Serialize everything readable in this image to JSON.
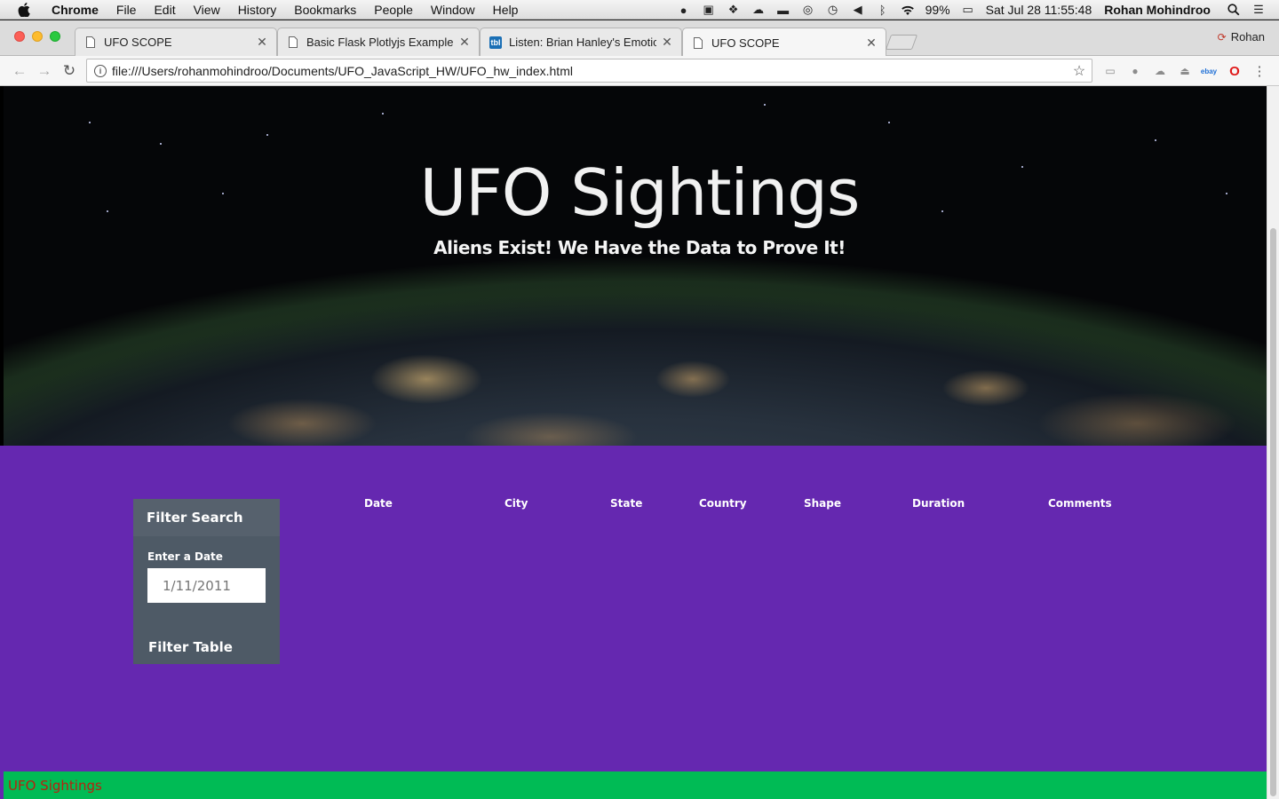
{
  "menubar": {
    "app_name": "Chrome",
    "items": [
      "File",
      "Edit",
      "View",
      "History",
      "Bookmarks",
      "People",
      "Window",
      "Help"
    ],
    "battery": "99%",
    "clock": "Sat Jul 28  11:55:48",
    "user": "Rohan Mohindroo"
  },
  "browser": {
    "tabs": [
      {
        "title": "UFO SCOPE",
        "icon": "page-icon"
      },
      {
        "title": "Basic Flask Plotlyjs Example",
        "icon": "page-icon"
      },
      {
        "title": "Listen: Brian Hanley's Emotion",
        "icon": "tbl-icon",
        "icon_text": "tbl"
      },
      {
        "title": "UFO SCOPE",
        "icon": "page-icon"
      }
    ],
    "profile_name": "Rohan",
    "url": "file:///Users/rohanmohindroo/Documents/UFO_JavaScript_HW/UFO_hw_index.html"
  },
  "hero": {
    "title": "UFO Sightings",
    "subtitle": "Aliens Exist! We Have the Data to Prove It!"
  },
  "filter": {
    "heading": "Filter Search",
    "date_label": "Enter a Date",
    "date_placeholder": "1/11/2011",
    "button_label": "Filter Table"
  },
  "table": {
    "columns": [
      "Date",
      "City",
      "State",
      "Country",
      "Shape",
      "Duration",
      "Comments"
    ]
  },
  "footer": {
    "text": "UFO Sightings"
  },
  "colors": {
    "content_bg": "#6528b0",
    "panel_bg": "#4e5a66",
    "footer_bg": "#00bb55",
    "footer_text": "#b8210f"
  }
}
